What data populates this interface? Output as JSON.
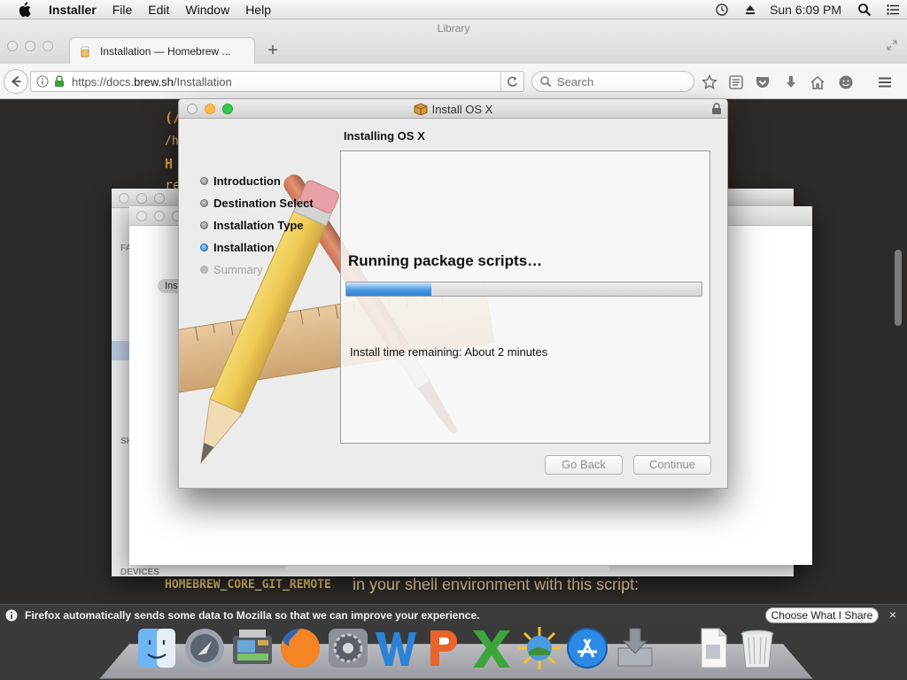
{
  "menubar": {
    "app_name": "Installer",
    "items": [
      "File",
      "Edit",
      "Window",
      "Help"
    ],
    "clock": "Sun 6:09 PM",
    "icons": [
      "apple-icon",
      "time-machine-icon",
      "eject-icon",
      "spotlight-icon",
      "notification-center-icon"
    ]
  },
  "firefox": {
    "ghost_title": "Library",
    "tab_label": "Installation — Homebrew ...",
    "new_tab": "+",
    "url_prefix": "https://docs.",
    "url_domain": "brew.sh",
    "url_path": "/Installation",
    "search_placeholder": "Search",
    "page_lines": {
      "l1": "(/",
      "l2": "/h",
      "l3": "H",
      "l4": "re",
      "bottom_code": "HOMEBREW_CORE_GIT_REMOTE",
      "bottom_text": " in your shell environment with this script:"
    },
    "notification": {
      "text": "Firefox automatically sends some data to Mozilla so that we can improve your experience.",
      "button": "Choose What I Share",
      "close": "×"
    }
  },
  "background_windows": {
    "sidebar_fa": "FA",
    "sidebar_sh": "SH",
    "sidebar_devices": "DEVICES",
    "pill_text": "Ins"
  },
  "installer": {
    "window_title": "Install OS X",
    "heading": "Installing OS X",
    "steps": [
      {
        "label": "Introduction",
        "state": "done"
      },
      {
        "label": "Destination Select",
        "state": "done"
      },
      {
        "label": "Installation Type",
        "state": "done"
      },
      {
        "label": "Installation",
        "state": "current"
      },
      {
        "label": "Summary",
        "state": "pending"
      }
    ],
    "status": "Running package scripts…",
    "progress": 0.24,
    "remaining": "Install time remaining: About 2 minutes",
    "buttons": {
      "back": "Go Back",
      "continue": "Continue"
    }
  },
  "dock": {
    "apps": [
      "finder-icon",
      "launchpad-icon",
      "image-capture-icon",
      "firefox-icon",
      "system-preferences-icon",
      "word-icon",
      "powerpoint-icon",
      "excel-icon",
      "iphoto-icon",
      "app-store-icon",
      "installer-icon",
      "document-icon",
      "trash-icon"
    ]
  },
  "colors": {
    "accent": "#2f7fd4",
    "page_bg": "#2d2a27",
    "code_text": "#d6c07a"
  }
}
